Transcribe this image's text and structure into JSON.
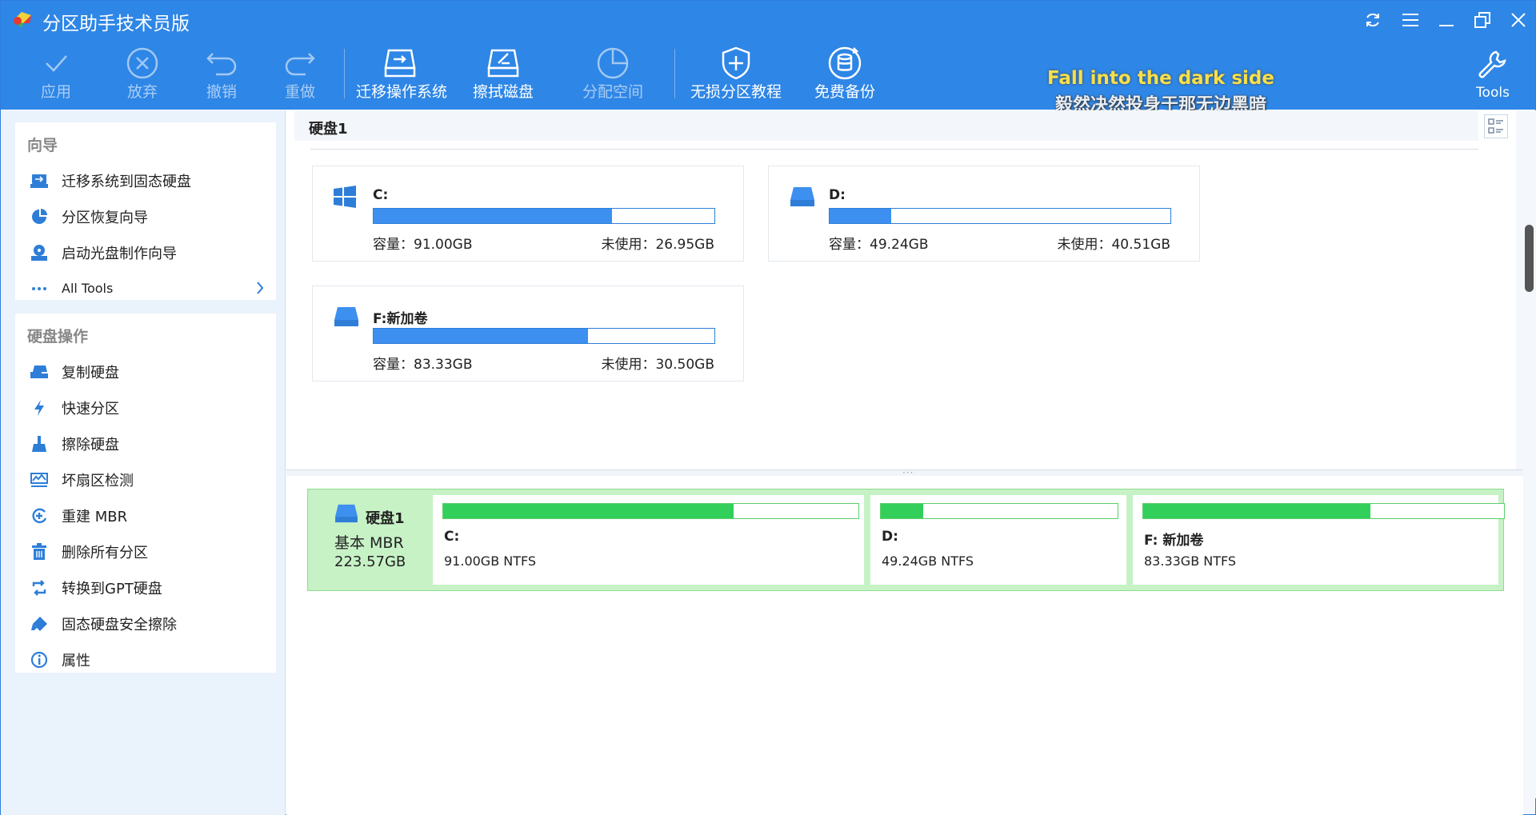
{
  "app": {
    "title": "分区助手技术员版"
  },
  "toolbar": {
    "apply": "应用",
    "discard": "放弃",
    "undo": "撤销",
    "redo": "重做",
    "migrate_os": "迁移操作系统",
    "wipe_disk": "擦拭磁盘",
    "allocate_space": "分配空间",
    "partition_tutorial": "无损分区教程",
    "free_backup": "免费备份",
    "tools": "Tools"
  },
  "subtitle": {
    "en": "Fall into the dark side",
    "cn": "毅然决然投身于那无边黑暗"
  },
  "sidebar": {
    "wizard": {
      "title": "向导",
      "items": [
        {
          "label": "迁移系统到固态硬盘",
          "icon": "migrate-ssd-icon"
        },
        {
          "label": "分区恢复向导",
          "icon": "partition-recovery-icon"
        },
        {
          "label": "启动光盘制作向导",
          "icon": "boot-disc-icon"
        },
        {
          "label": "All Tools",
          "icon": "more-dots-icon"
        }
      ]
    },
    "disk_ops": {
      "title": "硬盘操作",
      "items": [
        {
          "label": "复制硬盘",
          "icon": "copy-disk-icon"
        },
        {
          "label": "快速分区",
          "icon": "lightning-icon"
        },
        {
          "label": "擦除硬盘",
          "icon": "broom-icon"
        },
        {
          "label": "坏扇区检测",
          "icon": "bad-sector-icon"
        },
        {
          "label": "重建 MBR",
          "icon": "rebuild-mbr-icon"
        },
        {
          "label": "删除所有分区",
          "icon": "trash-icon"
        },
        {
          "label": "转换到GPT硬盘",
          "icon": "convert-icon"
        },
        {
          "label": "固态硬盘安全擦除",
          "icon": "eraser-icon"
        },
        {
          "label": "属性",
          "icon": "info-icon"
        }
      ]
    }
  },
  "disk_view": {
    "header": "硬盘1",
    "partitions": [
      {
        "name": "C:",
        "capacity": "容量：91.00GB",
        "free": "未使用：26.95GB",
        "used_fraction": 0.7,
        "icon": "windows-icon"
      },
      {
        "name": "D:",
        "capacity": "容量：49.24GB",
        "free": "未使用：40.51GB",
        "used_fraction": 0.18,
        "icon": "drive-icon"
      },
      {
        "name": "F:新加卷",
        "capacity": "容量：83.33GB",
        "free": "未使用：30.50GB",
        "used_fraction": 0.63,
        "icon": "drive-icon"
      }
    ]
  },
  "disk_map": {
    "disk_name": "硬盘1",
    "disk_type": "基本 MBR",
    "disk_size": "223.57GB",
    "partitions": [
      {
        "name": "C:",
        "info": "91.00GB NTFS",
        "used_fraction": 0.7
      },
      {
        "name": "D:",
        "info": "49.24GB NTFS",
        "used_fraction": 0.18
      },
      {
        "name": "F: 新加卷",
        "info": "83.33GB NTFS",
        "used_fraction": 0.63
      }
    ]
  },
  "colors": {
    "accent": "#2e86e6",
    "bar_blue": "#3d8ff0",
    "bar_green": "#32d05a",
    "disk_bg": "#c7f2c6"
  }
}
